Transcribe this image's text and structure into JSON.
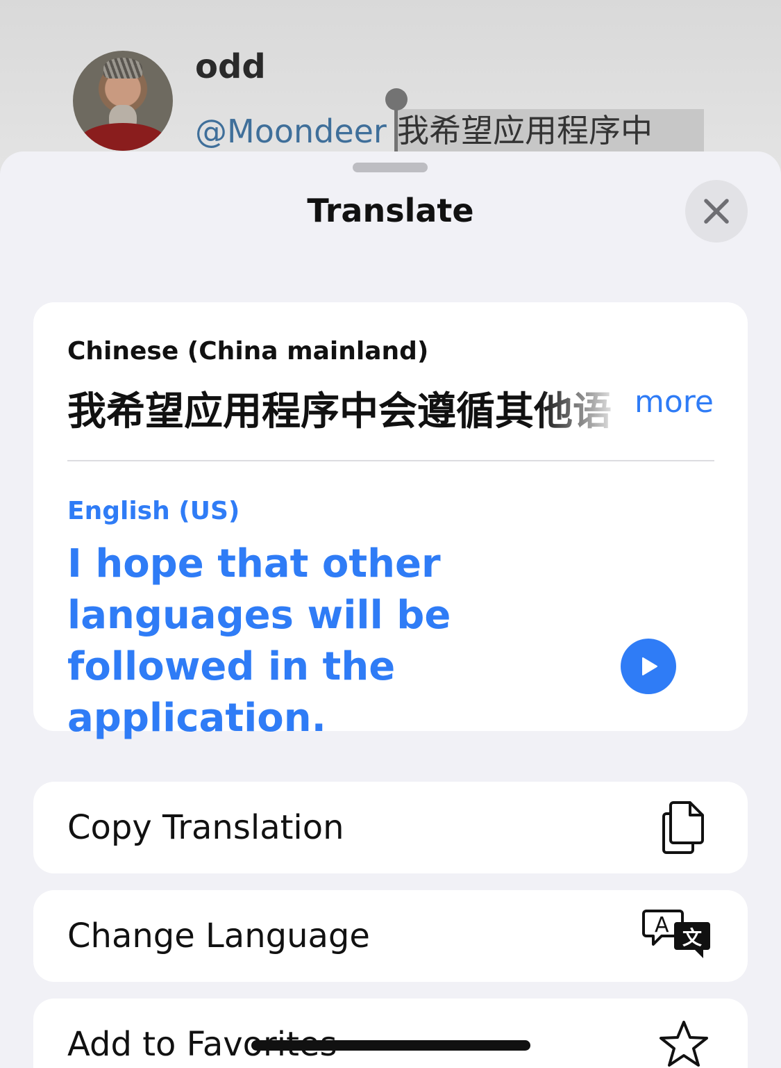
{
  "post": {
    "name": "odd",
    "handle": "@Moondeer",
    "selected_text": "我希望应用程序中"
  },
  "sheet": {
    "title": "Translate"
  },
  "translation": {
    "source_language": "Chinese (China mainland)",
    "source_text": "我希望应用程序中会遵循其他语",
    "more_label": "more",
    "target_language": "English (US)",
    "target_text": "I hope that other languages will be followed in the application."
  },
  "actions": [
    {
      "label": "Copy Translation",
      "icon": "copy-icon"
    },
    {
      "label": "Change Language",
      "icon": "translate-icon"
    },
    {
      "label": "Add to Favorites",
      "icon": "star-icon"
    }
  ],
  "colors": {
    "accent": "#2f7cf6",
    "sheet_background": "#f1f1f6",
    "card_background": "#ffffff"
  }
}
